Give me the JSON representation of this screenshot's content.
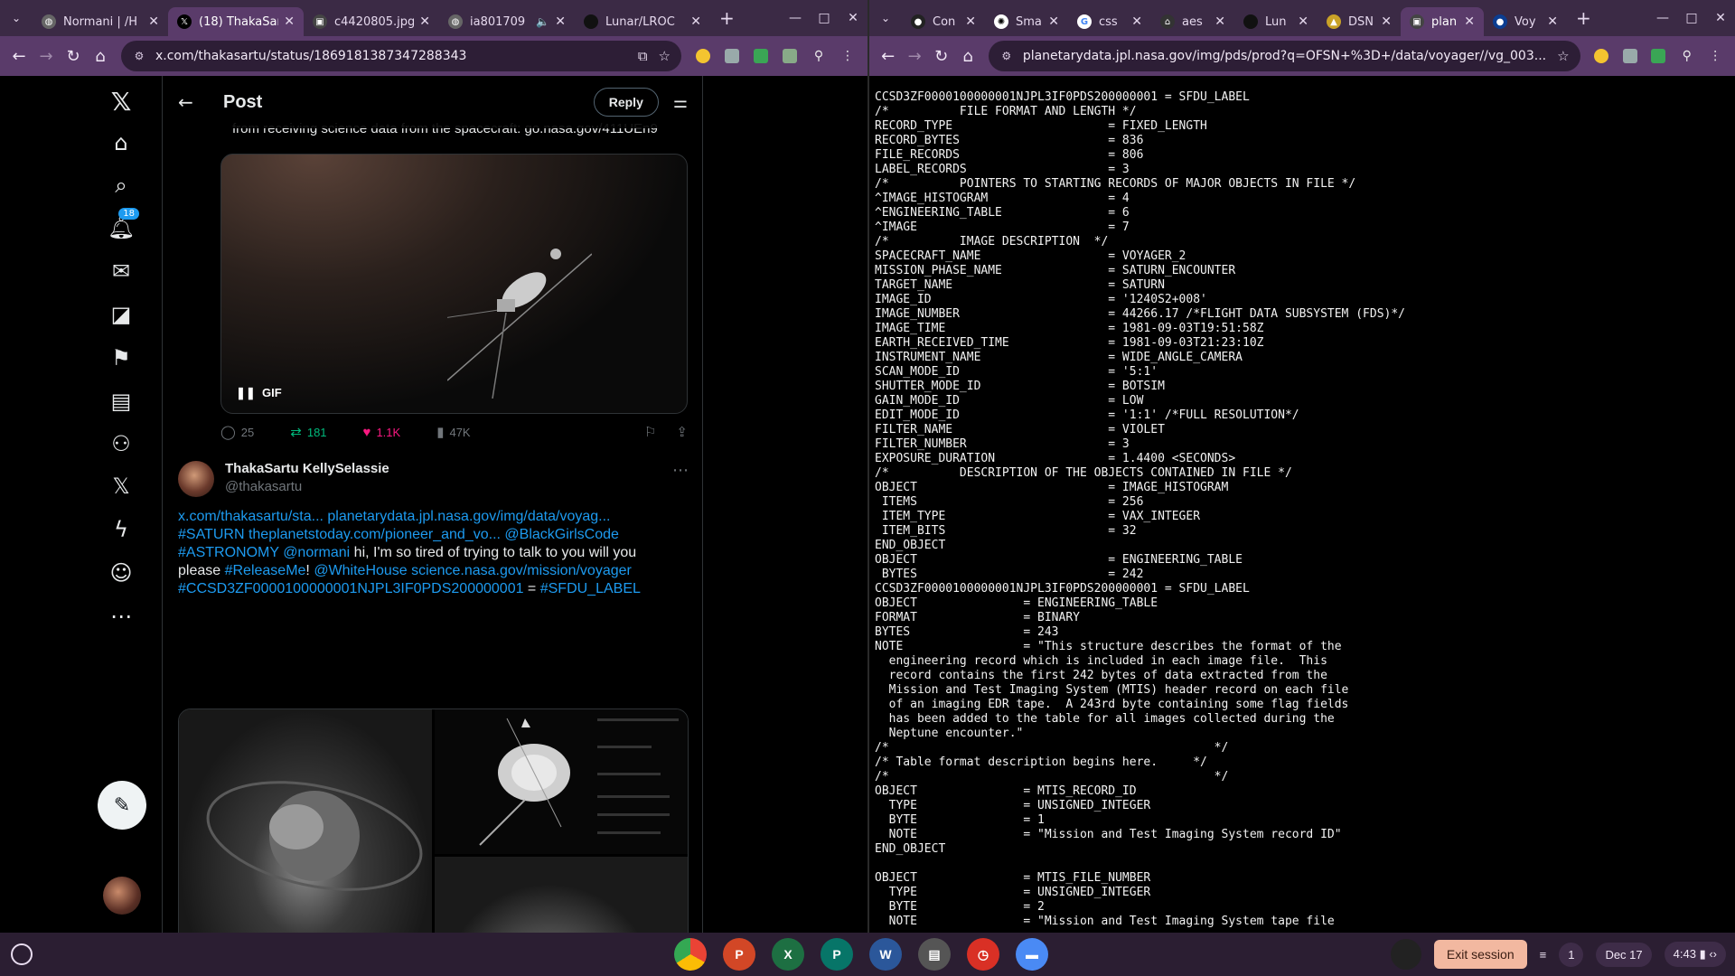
{
  "left_browser": {
    "tabs": [
      {
        "title": "Normani | /H",
        "favicon": "globe"
      },
      {
        "title": "(18) ThakaSar",
        "favicon": "x-logo",
        "active": true
      },
      {
        "title": "c4420805.jpg",
        "favicon": "image"
      },
      {
        "title": "ia801709",
        "favicon": "globe",
        "muted": true
      },
      {
        "title": "Lunar/LROC",
        "favicon": "dark"
      }
    ],
    "url": "x.com/thakasartu/status/1869181387347288343"
  },
  "x_post": {
    "header_title": "Post",
    "reply_button": "Reply",
    "notification_count": "18",
    "truncated_text": "from receiving science data from the spacecraft: go.nasa.gov/411UEn9",
    "gif_label": "GIF",
    "replies": "25",
    "reposts": "181",
    "likes": "1.1K",
    "views": "47K",
    "reply": {
      "name": "ThakaSartu KellySelassie",
      "handle": "@thakasartu",
      "line1_links": "x.com/thakasartu/sta... planetarydata.jpl.nasa.gov/img/data/voyag...",
      "line2_tag": "#SATURN",
      "line2_link": "theplanetstoday.com/pioneer_and_vo...",
      "line2_mention": "@BlackGirlsCode",
      "line3_tag": "#ASTRONOMY",
      "line3_mention": "@normani",
      "line3_text": " hi, I'm so tired of trying to talk to you will you",
      "line4_text": "please ",
      "line4_tag": "#ReleaseMe",
      "line4_excl": "! ",
      "line4_mention": "@WhiteHouse",
      "line4_link": "science.nasa.gov/mission/voyager",
      "line5_tag1": "#CCSD3ZF0000100000001NJPL3IF0PDS200000001",
      "line5_eq": " = ",
      "line5_tag2": "#SFDU_LABEL"
    }
  },
  "right_browser": {
    "tabs": [
      {
        "title": "Con",
        "favicon": "github"
      },
      {
        "title": "Sma",
        "favicon": "openai"
      },
      {
        "title": "css",
        "favicon": "google"
      },
      {
        "title": "aes",
        "favicon": "museum"
      },
      {
        "title": "Lun",
        "favicon": "dark"
      },
      {
        "title": "DSN",
        "favicon": "dsn"
      },
      {
        "title": "plan",
        "favicon": "image",
        "active": true
      },
      {
        "title": "Voy",
        "favicon": "nasa"
      }
    ],
    "url": "planetarydata.jpl.nasa.gov/img/pds/prod?q=OFSN+%3D+/data/voyager//vg_003..."
  },
  "pds_label": "CCSD3ZF0000100000001NJPL3IF0PDS200000001 = SFDU_LABEL\n/*          FILE FORMAT AND LENGTH */\nRECORD_TYPE                      = FIXED_LENGTH\nRECORD_BYTES                     = 836\nFILE_RECORDS                     = 806\nLABEL_RECORDS                    = 3\n/*          POINTERS TO STARTING RECORDS OF MAJOR OBJECTS IN FILE */\n^IMAGE_HISTOGRAM                 = 4\n^ENGINEERING_TABLE               = 6\n^IMAGE                           = 7\n/*          IMAGE DESCRIPTION  */\nSPACECRAFT_NAME                  = VOYAGER_2\nMISSION_PHASE_NAME               = SATURN_ENCOUNTER\nTARGET_NAME                      = SATURN\nIMAGE_ID                         = '1240S2+008'\nIMAGE_NUMBER                     = 44266.17 /*FLIGHT DATA SUBSYSTEM (FDS)*/\nIMAGE_TIME                       = 1981-09-03T19:51:58Z\nEARTH_RECEIVED_TIME              = 1981-09-03T21:23:10Z\nINSTRUMENT_NAME                  = WIDE_ANGLE_CAMERA\nSCAN_MODE_ID                     = '5:1'\nSHUTTER_MODE_ID                  = BOTSIM\nGAIN_MODE_ID                     = LOW\nEDIT_MODE_ID                     = '1:1' /*FULL RESOLUTION*/\nFILTER_NAME                      = VIOLET\nFILTER_NUMBER                    = 3\nEXPOSURE_DURATION                = 1.4400 <SECONDS>\n/*          DESCRIPTION OF THE OBJECTS CONTAINED IN FILE */\nOBJECT                           = IMAGE_HISTOGRAM\n ITEMS                           = 256\n ITEM_TYPE                       = VAX_INTEGER\n ITEM_BITS                       = 32\nEND_OBJECT\nOBJECT                           = ENGINEERING_TABLE\n BYTES                           = 242\nCCSD3ZF0000100000001NJPL3IF0PDS200000001 = SFDU_LABEL\nOBJECT               = ENGINEERING_TABLE\nFORMAT               = BINARY\nBYTES                = 243\nNOTE                 = \"This structure describes the format of the\n  engineering record which is included in each image file.  This\n  record contains the first 242 bytes of data extracted from the\n  Mission and Test Imaging System (MTIS) header record on each file\n  of an imaging EDR tape.  A 243rd byte containing some flag fields\n  has been added to the table for all images collected during the\n  Neptune encounter.\"\n/*                                              */\n/* Table format description begins here.     */\n/*                                              */\nOBJECT               = MTIS_RECORD_ID\n  TYPE               = UNSIGNED_INTEGER\n  BYTE               = 1\n  NOTE               = \"Mission and Test Imaging System record ID\"\nEND_OBJECT\n\nOBJECT               = MTIS_FILE_NUMBER\n  TYPE               = UNSIGNED_INTEGER\n  BYTE               = 2\n  NOTE               = \"Mission and Test Imaging System tape file",
  "shelf": {
    "exit_session": "Exit session",
    "notif_count": "1",
    "date": "Dec 17",
    "time": "4:43"
  },
  "colors": {
    "x_blue": "#1d9bf0",
    "repost_green": "#00ba7c",
    "like_pink": "#f91880",
    "frame_purple": "#5a3b6a"
  }
}
